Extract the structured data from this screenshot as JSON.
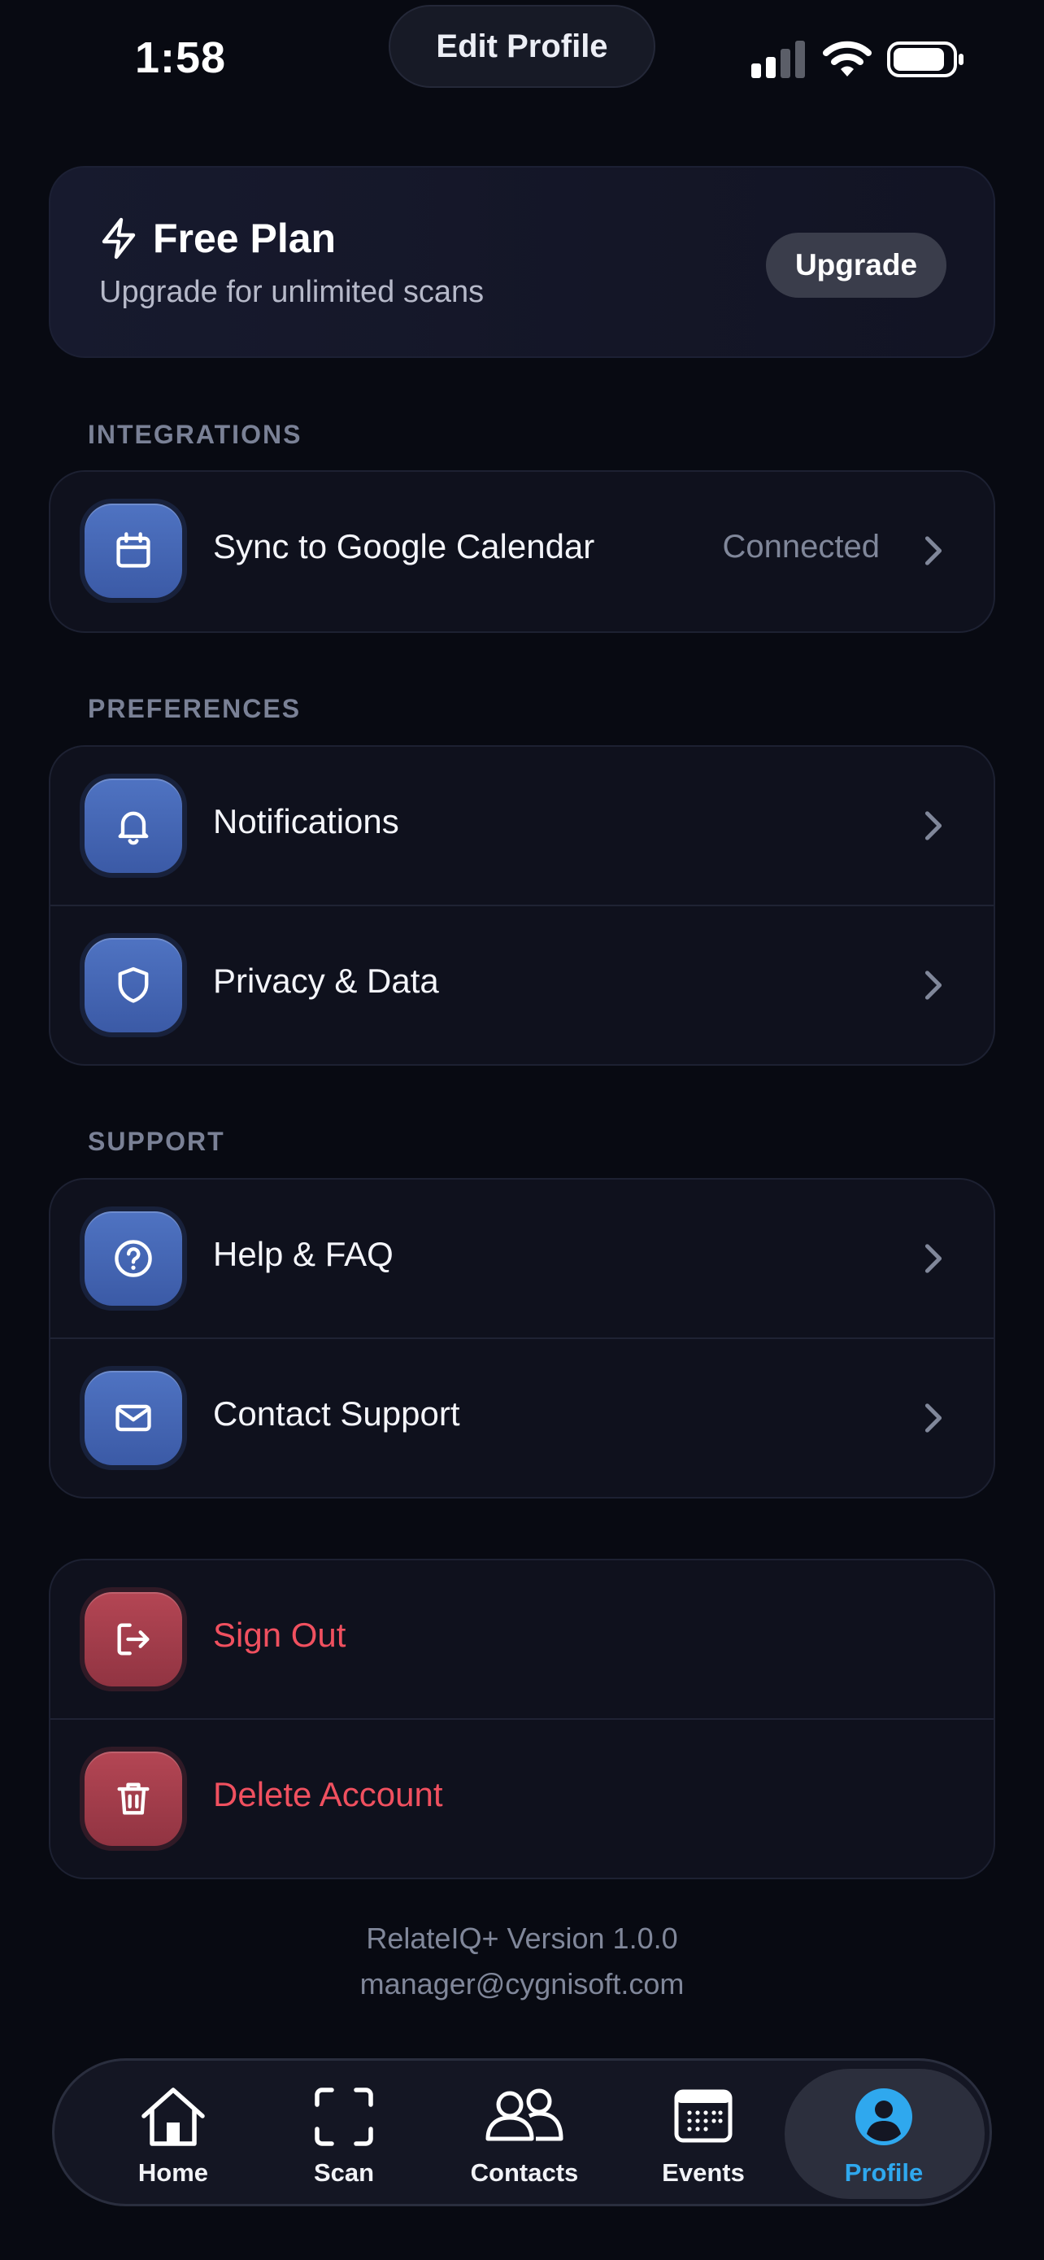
{
  "status_bar": {
    "time": "1:58"
  },
  "header": {
    "edit_profile_label": "Edit Profile"
  },
  "plan": {
    "title": "Free Plan",
    "subtitle": "Upgrade for unlimited scans",
    "upgrade_label": "Upgrade"
  },
  "integrations": {
    "title": "INTEGRATIONS",
    "items": [
      {
        "label": "Sync to Google Calendar",
        "status": "Connected",
        "icon": "calendar-icon"
      }
    ]
  },
  "preferences": {
    "title": "PREFERENCES",
    "items": [
      {
        "label": "Notifications",
        "icon": "bell-icon"
      },
      {
        "label": "Privacy & Data",
        "icon": "shield-icon"
      }
    ]
  },
  "support": {
    "title": "SUPPORT",
    "items": [
      {
        "label": "Help & FAQ",
        "icon": "help-circle-icon"
      },
      {
        "label": "Contact Support",
        "icon": "mail-icon"
      }
    ]
  },
  "account": {
    "items": [
      {
        "label": "Sign Out",
        "icon": "sign-out-icon"
      },
      {
        "label": "Delete Account",
        "icon": "trash-icon"
      }
    ]
  },
  "footer": {
    "version": "RelateIQ+ Version 1.0.0",
    "email": "manager@cygnisoft.com"
  },
  "tabs": [
    {
      "label": "Home",
      "icon": "home-icon"
    },
    {
      "label": "Scan",
      "icon": "scan-icon"
    },
    {
      "label": "Contacts",
      "icon": "contacts-icon"
    },
    {
      "label": "Events",
      "icon": "calendar-grid-icon"
    },
    {
      "label": "Profile",
      "icon": "profile-icon",
      "active": true
    }
  ],
  "colors": {
    "background": "#080a12",
    "accent_blue": "#2fa8ee",
    "danger": "#f0505f",
    "icon_blue": "#4a6bb9",
    "icon_red": "#a63d4b"
  }
}
